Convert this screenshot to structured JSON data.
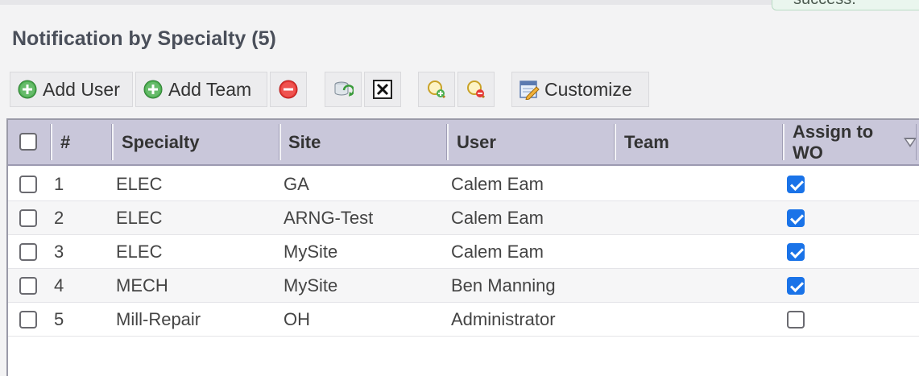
{
  "toast": {
    "text": "success."
  },
  "page": {
    "title": "Notification by Specialty (5)"
  },
  "toolbar": {
    "add_user_label": "Add User",
    "add_team_label": "Add Team",
    "customize_label": "Customize",
    "icons": [
      "add-user-icon",
      "add-team-icon",
      "remove-icon",
      "refresh-icon",
      "clear-icon",
      "zoom-in-icon",
      "zoom-out-icon",
      "customize-icon"
    ]
  },
  "grid": {
    "columns": [
      "#",
      "Specialty",
      "Site",
      "User",
      "Team",
      "Assign to WO"
    ],
    "rows": [
      {
        "num": "1",
        "specialty": "ELEC",
        "site": "GA",
        "user": "Calem Eam",
        "team": "",
        "assign": true
      },
      {
        "num": "2",
        "specialty": "ELEC",
        "site": "ARNG-Test",
        "user": "Calem Eam",
        "team": "",
        "assign": true
      },
      {
        "num": "3",
        "specialty": "ELEC",
        "site": "MySite",
        "user": "Calem Eam",
        "team": "",
        "assign": true
      },
      {
        "num": "4",
        "specialty": "MECH",
        "site": "MySite",
        "user": "Ben Manning",
        "team": "",
        "assign": true
      },
      {
        "num": "5",
        "specialty": "Mill-Repair",
        "site": "OH",
        "user": "Administrator",
        "team": "",
        "assign": false
      }
    ]
  },
  "colors": {
    "accent": "#1a73e8",
    "header_bg": "#c9c7da",
    "title": "#4a4f5a"
  }
}
